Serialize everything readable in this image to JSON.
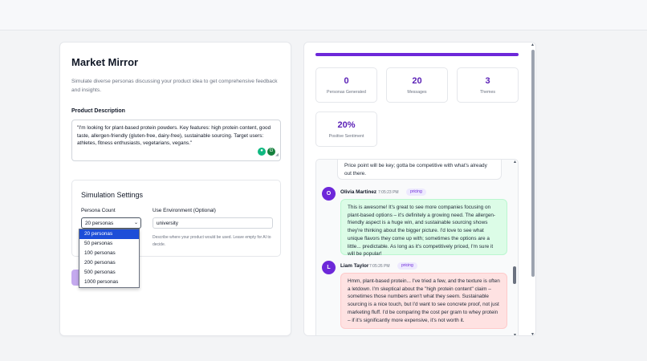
{
  "left": {
    "title": "Market Mirror",
    "subtitle": "Simulate diverse personas discussing your product idea to get comprehensive feedback and insights.",
    "description_label": "Product Description",
    "description_value": "\"I'm looking for plant-based protein powders. Key features: high protein content, good taste, allergen-friendly (gluten-free, dairy-free), sustainable sourcing. Target users: athletes, fitness enthusiasts, vegetarians, vegans.\"",
    "settings": {
      "title": "Simulation Settings",
      "persona_label": "Persona Count",
      "persona_selected": "20 personas",
      "persona_options": [
        "20 personas",
        "50 personas",
        "100 personas",
        "200 personas",
        "500 personas",
        "1000 personas"
      ],
      "env_label": "Use Environment (Optional)",
      "env_value": "university",
      "env_help": "Describe where your product would be used. Leave empty for AI to decide."
    }
  },
  "right": {
    "progress": 1.0,
    "stats": [
      {
        "value": "0",
        "label": "Personas Generated"
      },
      {
        "value": "20",
        "label": "Messages"
      },
      {
        "value": "3",
        "label": "Themes"
      },
      {
        "value": "20%",
        "label": "Positive Sentiment"
      }
    ],
    "messages": [
      {
        "text": "Price point will be key; gotta be competitive with what's already out there."
      },
      {
        "initial": "O",
        "name": "Olivia Martinez",
        "time": "7:05:23 PM",
        "tag": "pricing",
        "text": "This is awesome! It's great to see more companies focusing on plant-based options – it's definitely a growing need. The allergen-friendly aspect is a huge win, and sustainable sourcing shows they're thinking about the bigger picture. I'd love to see what unique flavors they come up with; sometimes the options are a little... predictable. As long as it's competitively priced, I'm sure it will be popular!"
      },
      {
        "initial": "L",
        "name": "Liam Taylor",
        "time": "7:05:26 PM",
        "tag": "pricing",
        "text": "Hmm, plant-based protein... I've tried a few, and the texture is often a letdown. I'm skeptical about the \"high protein content\" claim – sometimes those numbers aren't what they seem. Sustainable sourcing is a nice touch, but I'd want to see concrete proof, not just marketing fluff. I'd be comparing the cost per gram to whey protein – if it's significantly more expensive, it's not worth it."
      }
    ]
  },
  "colors": {
    "accent": "#6d28d9",
    "stat_value": "#5b21b6",
    "positive_bubble": "#dcfce7",
    "negative_bubble": "#fee2e2"
  }
}
